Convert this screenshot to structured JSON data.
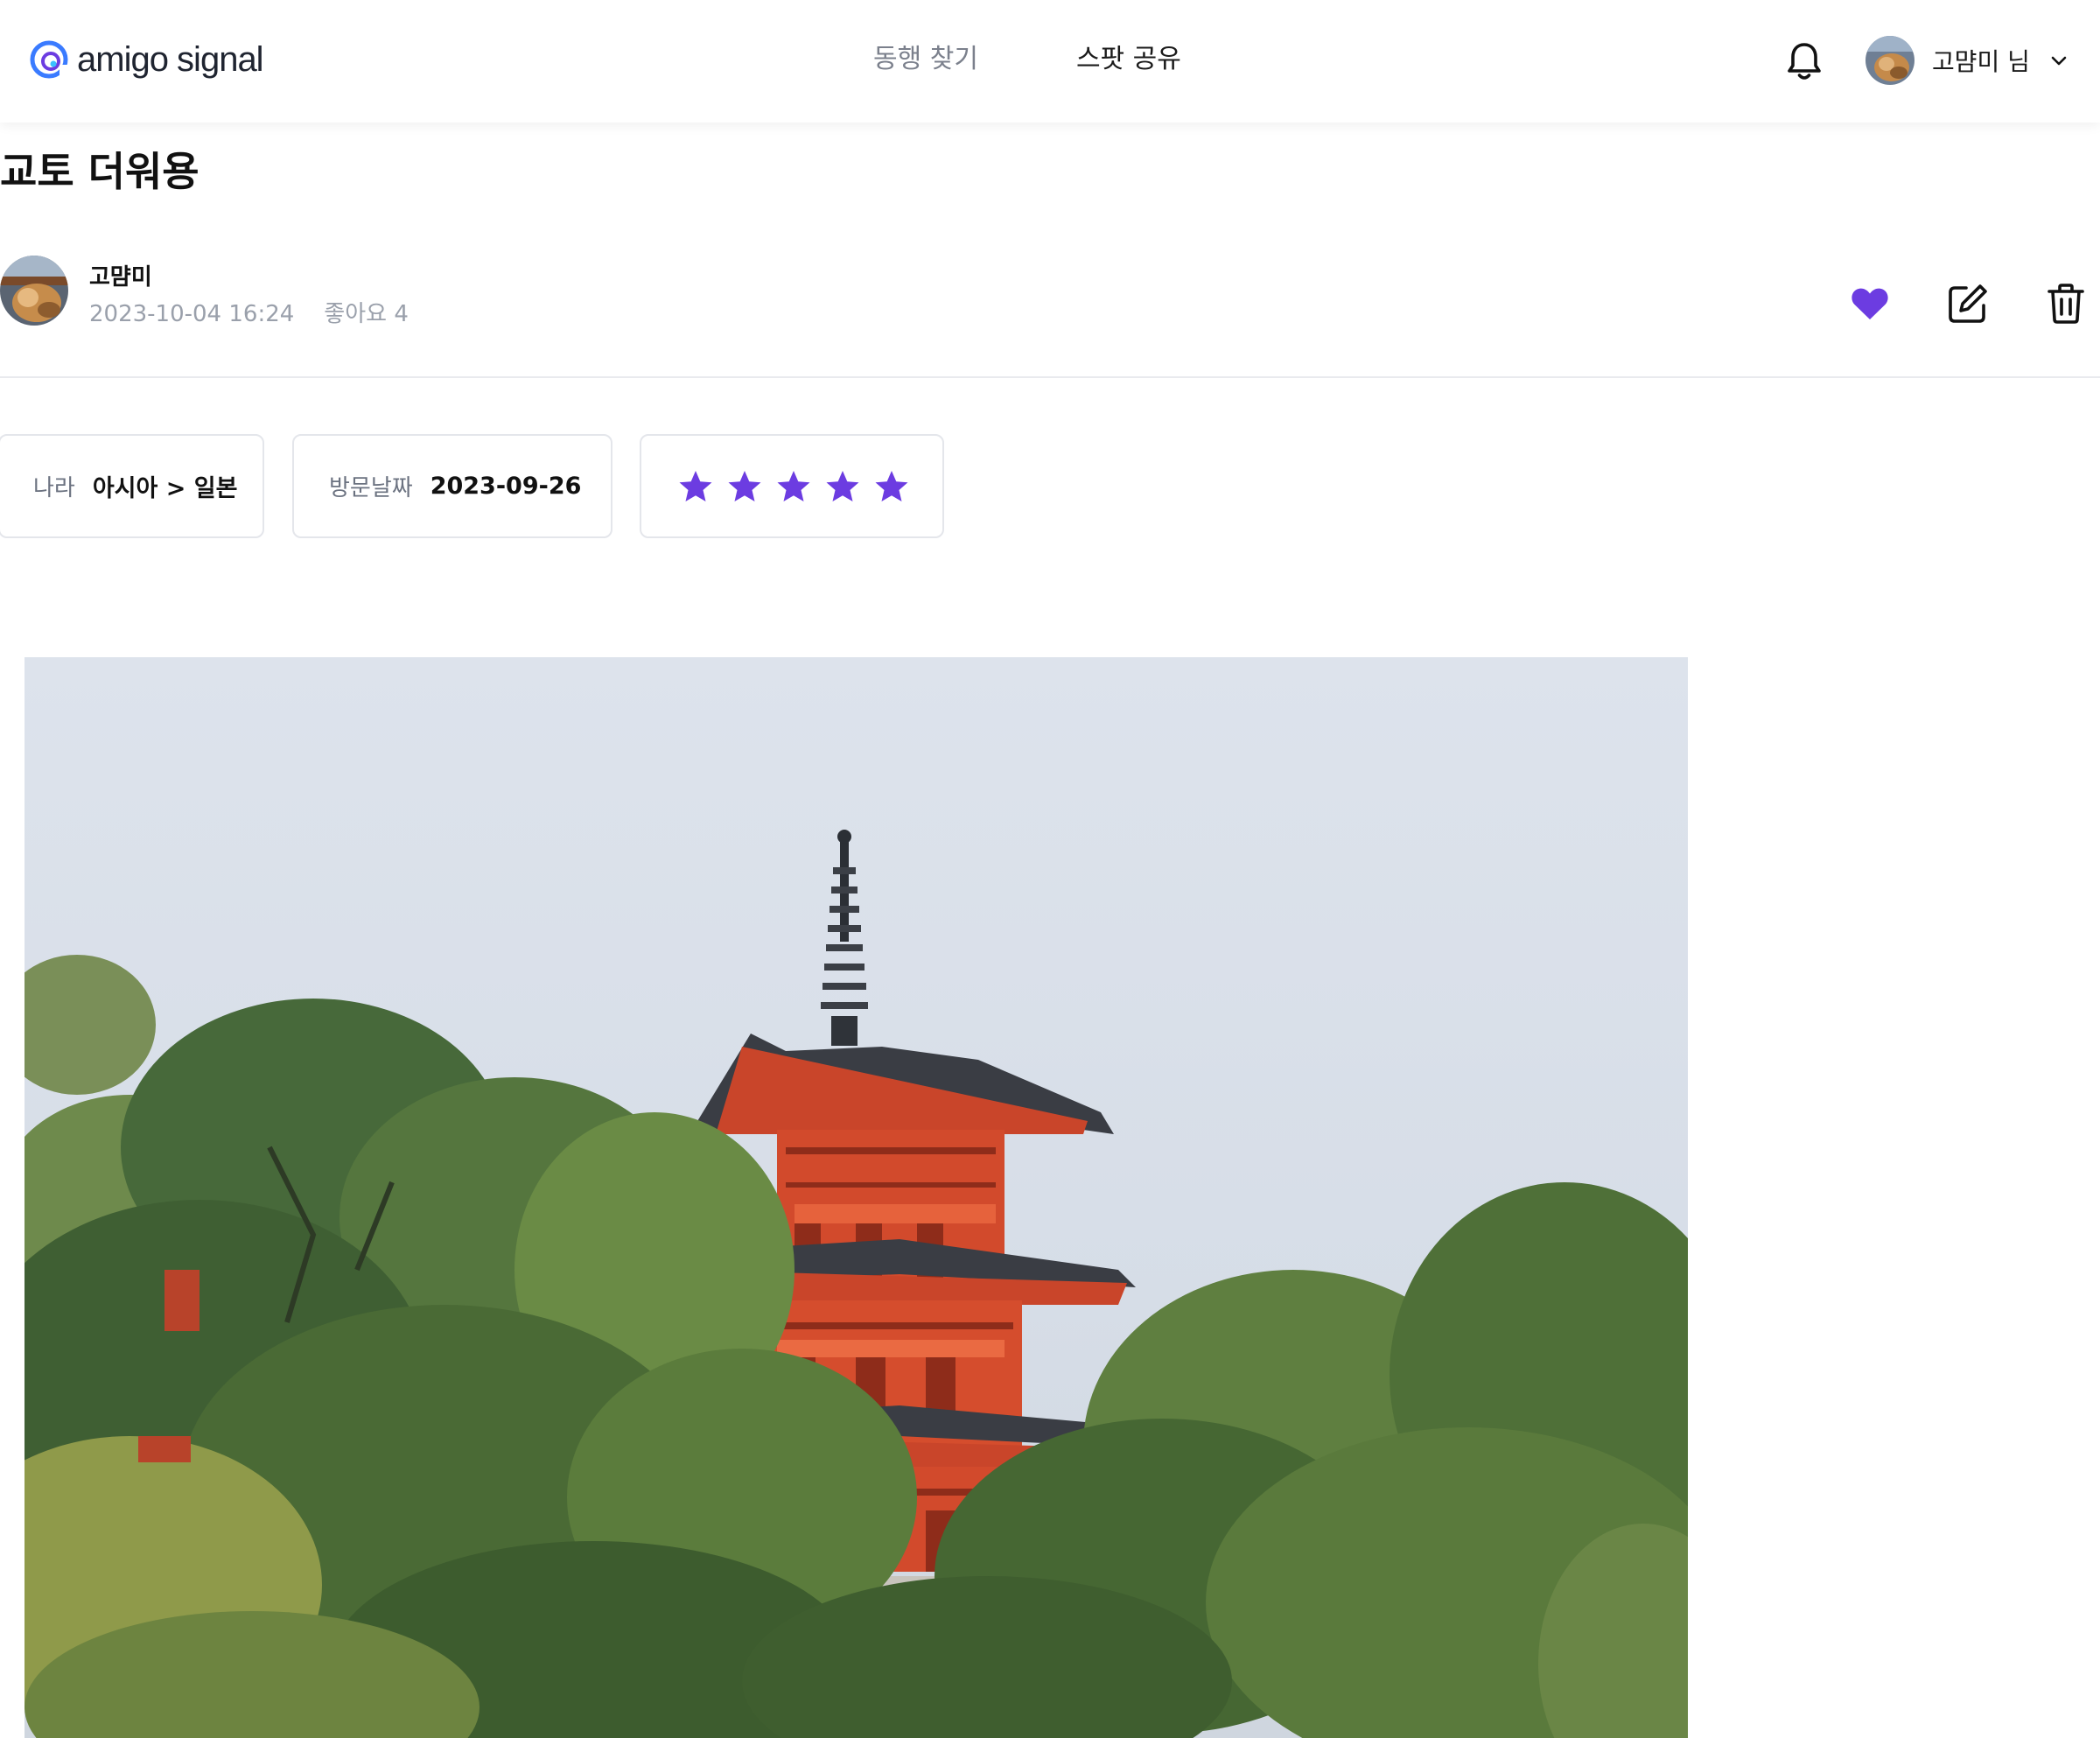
{
  "header": {
    "logo_text": "amigo signal",
    "nav": [
      {
        "label": "동행 찾기",
        "active": false
      },
      {
        "label": "스팟 공유",
        "active": true
      }
    ],
    "user_label": "고먐미 님"
  },
  "post": {
    "title": "교토 더워용",
    "author": "고먐미",
    "datetime": "2023-10-04 16:24",
    "likes_label": "좋아요 4"
  },
  "info": {
    "country_label": "나라",
    "country_value": "아시아 > 일본",
    "visit_label": "방문날짜",
    "visit_value": "2023-09-26",
    "rating": 5
  },
  "colors": {
    "accent": "#6c3ce1",
    "muted_text": "#9aa0ab",
    "border": "#e4e6eb"
  },
  "icons": [
    "bell-icon",
    "chevron-down-icon",
    "heart-icon",
    "edit-icon",
    "trash-icon",
    "star-icon"
  ]
}
